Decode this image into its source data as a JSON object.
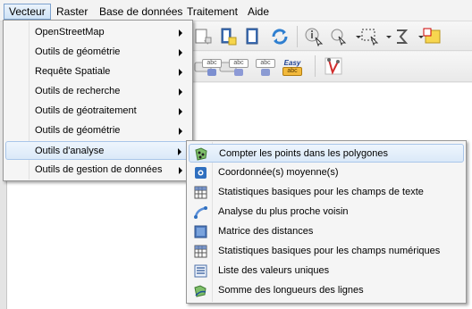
{
  "menubar": {
    "items": [
      {
        "label": "Vecteur",
        "active": true
      },
      {
        "label": "Raster"
      },
      {
        "label": "Base de données"
      },
      {
        "label": "Traitement"
      },
      {
        "label": "Aide"
      }
    ]
  },
  "vector_menu": {
    "items": [
      {
        "label": "OpenStreetMap",
        "has_submenu": true
      },
      {
        "label": "Outils de géométrie",
        "has_submenu": true
      },
      {
        "label": "Requête Spatiale",
        "has_submenu": true
      },
      {
        "label": "Outils de recherche",
        "has_submenu": true
      },
      {
        "label": "Outils de géotraitement",
        "has_submenu": true
      },
      {
        "label": "Outils de géométrie",
        "has_submenu": true
      },
      {
        "label": "Outils d'analyse",
        "has_submenu": true,
        "highlighted": true
      },
      {
        "label": "Outils de gestion de données",
        "has_submenu": true
      }
    ]
  },
  "analysis_submenu": {
    "items": [
      {
        "label": "Compter les points dans les polygones",
        "icon": "count-points-icon",
        "highlighted": true
      },
      {
        "label": "Coordonnée(s) moyenne(s)",
        "icon": "mean-coordinates-icon"
      },
      {
        "label": "Statistiques basiques pour les champs de texte",
        "icon": "table-stats-icon"
      },
      {
        "label": "Analyse du plus proche voisin",
        "icon": "nearest-neighbour-icon"
      },
      {
        "label": "Matrice des distances",
        "icon": "distance-matrix-icon"
      },
      {
        "label": "Statistiques basiques pour les champs numériques",
        "icon": "table-stats-icon"
      },
      {
        "label": "Liste des valeurs uniques",
        "icon": "unique-values-icon"
      },
      {
        "label": "Somme des longueurs des lignes",
        "icon": "sum-lines-icon"
      }
    ]
  },
  "toolbar": {
    "label_tools": [
      "abc",
      "abc",
      "abc",
      "abc"
    ],
    "easy_label": {
      "top": "Easy",
      "bottom": "abc"
    }
  },
  "colors": {
    "accent_blue": "#2f6fbf",
    "highlight_border": "#a9c6ea",
    "menu_bg": "#f5f5f5"
  }
}
